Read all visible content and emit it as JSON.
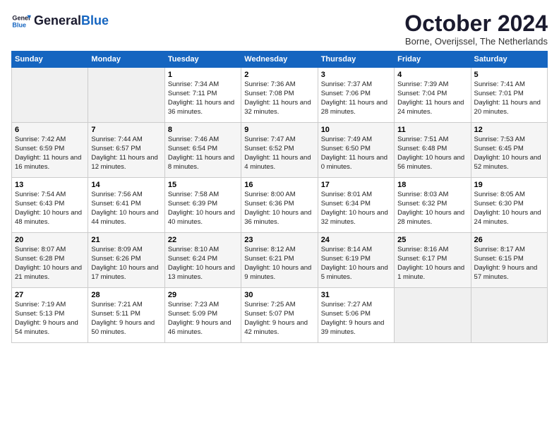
{
  "logo": {
    "line1": "General",
    "line2": "Blue"
  },
  "title": "October 2024",
  "subtitle": "Borne, Overijssel, The Netherlands",
  "days_of_week": [
    "Sunday",
    "Monday",
    "Tuesday",
    "Wednesday",
    "Thursday",
    "Friday",
    "Saturday"
  ],
  "weeks": [
    [
      {
        "day": "",
        "info": ""
      },
      {
        "day": "",
        "info": ""
      },
      {
        "day": "1",
        "info": "Sunrise: 7:34 AM\nSunset: 7:11 PM\nDaylight: 11 hours and 36 minutes."
      },
      {
        "day": "2",
        "info": "Sunrise: 7:36 AM\nSunset: 7:08 PM\nDaylight: 11 hours and 32 minutes."
      },
      {
        "day": "3",
        "info": "Sunrise: 7:37 AM\nSunset: 7:06 PM\nDaylight: 11 hours and 28 minutes."
      },
      {
        "day": "4",
        "info": "Sunrise: 7:39 AM\nSunset: 7:04 PM\nDaylight: 11 hours and 24 minutes."
      },
      {
        "day": "5",
        "info": "Sunrise: 7:41 AM\nSunset: 7:01 PM\nDaylight: 11 hours and 20 minutes."
      }
    ],
    [
      {
        "day": "6",
        "info": "Sunrise: 7:42 AM\nSunset: 6:59 PM\nDaylight: 11 hours and 16 minutes."
      },
      {
        "day": "7",
        "info": "Sunrise: 7:44 AM\nSunset: 6:57 PM\nDaylight: 11 hours and 12 minutes."
      },
      {
        "day": "8",
        "info": "Sunrise: 7:46 AM\nSunset: 6:54 PM\nDaylight: 11 hours and 8 minutes."
      },
      {
        "day": "9",
        "info": "Sunrise: 7:47 AM\nSunset: 6:52 PM\nDaylight: 11 hours and 4 minutes."
      },
      {
        "day": "10",
        "info": "Sunrise: 7:49 AM\nSunset: 6:50 PM\nDaylight: 11 hours and 0 minutes."
      },
      {
        "day": "11",
        "info": "Sunrise: 7:51 AM\nSunset: 6:48 PM\nDaylight: 10 hours and 56 minutes."
      },
      {
        "day": "12",
        "info": "Sunrise: 7:53 AM\nSunset: 6:45 PM\nDaylight: 10 hours and 52 minutes."
      }
    ],
    [
      {
        "day": "13",
        "info": "Sunrise: 7:54 AM\nSunset: 6:43 PM\nDaylight: 10 hours and 48 minutes."
      },
      {
        "day": "14",
        "info": "Sunrise: 7:56 AM\nSunset: 6:41 PM\nDaylight: 10 hours and 44 minutes."
      },
      {
        "day": "15",
        "info": "Sunrise: 7:58 AM\nSunset: 6:39 PM\nDaylight: 10 hours and 40 minutes."
      },
      {
        "day": "16",
        "info": "Sunrise: 8:00 AM\nSunset: 6:36 PM\nDaylight: 10 hours and 36 minutes."
      },
      {
        "day": "17",
        "info": "Sunrise: 8:01 AM\nSunset: 6:34 PM\nDaylight: 10 hours and 32 minutes."
      },
      {
        "day": "18",
        "info": "Sunrise: 8:03 AM\nSunset: 6:32 PM\nDaylight: 10 hours and 28 minutes."
      },
      {
        "day": "19",
        "info": "Sunrise: 8:05 AM\nSunset: 6:30 PM\nDaylight: 10 hours and 24 minutes."
      }
    ],
    [
      {
        "day": "20",
        "info": "Sunrise: 8:07 AM\nSunset: 6:28 PM\nDaylight: 10 hours and 21 minutes."
      },
      {
        "day": "21",
        "info": "Sunrise: 8:09 AM\nSunset: 6:26 PM\nDaylight: 10 hours and 17 minutes."
      },
      {
        "day": "22",
        "info": "Sunrise: 8:10 AM\nSunset: 6:24 PM\nDaylight: 10 hours and 13 minutes."
      },
      {
        "day": "23",
        "info": "Sunrise: 8:12 AM\nSunset: 6:21 PM\nDaylight: 10 hours and 9 minutes."
      },
      {
        "day": "24",
        "info": "Sunrise: 8:14 AM\nSunset: 6:19 PM\nDaylight: 10 hours and 5 minutes."
      },
      {
        "day": "25",
        "info": "Sunrise: 8:16 AM\nSunset: 6:17 PM\nDaylight: 10 hours and 1 minute."
      },
      {
        "day": "26",
        "info": "Sunrise: 8:17 AM\nSunset: 6:15 PM\nDaylight: 9 hours and 57 minutes."
      }
    ],
    [
      {
        "day": "27",
        "info": "Sunrise: 7:19 AM\nSunset: 5:13 PM\nDaylight: 9 hours and 54 minutes."
      },
      {
        "day": "28",
        "info": "Sunrise: 7:21 AM\nSunset: 5:11 PM\nDaylight: 9 hours and 50 minutes."
      },
      {
        "day": "29",
        "info": "Sunrise: 7:23 AM\nSunset: 5:09 PM\nDaylight: 9 hours and 46 minutes."
      },
      {
        "day": "30",
        "info": "Sunrise: 7:25 AM\nSunset: 5:07 PM\nDaylight: 9 hours and 42 minutes."
      },
      {
        "day": "31",
        "info": "Sunrise: 7:27 AM\nSunset: 5:06 PM\nDaylight: 9 hours and 39 minutes."
      },
      {
        "day": "",
        "info": ""
      },
      {
        "day": "",
        "info": ""
      }
    ]
  ]
}
